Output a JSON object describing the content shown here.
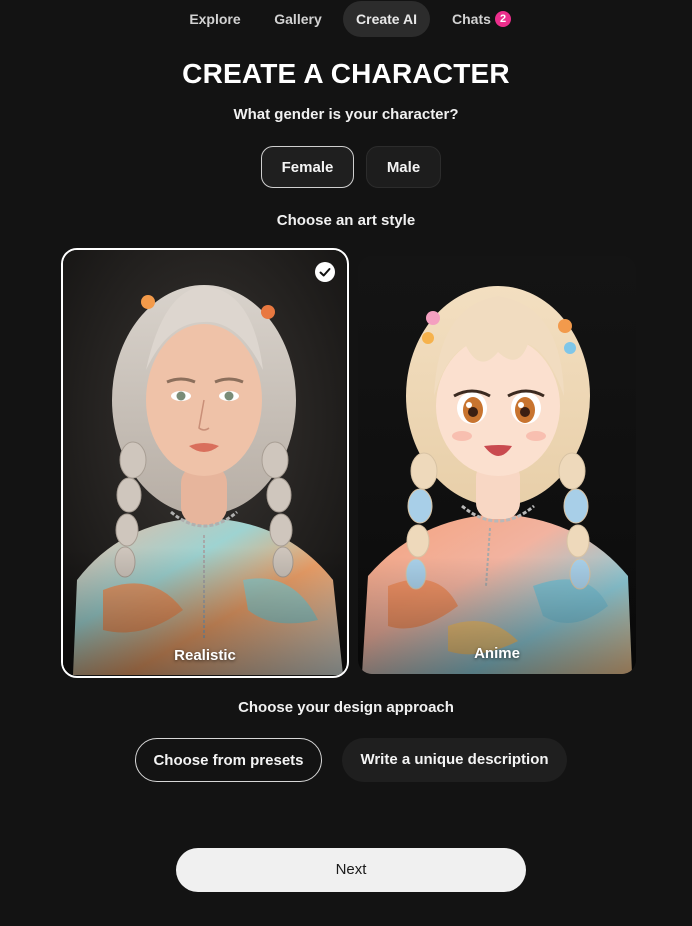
{
  "nav": {
    "items": [
      {
        "label": "Explore"
      },
      {
        "label": "Gallery"
      },
      {
        "label": "Create AI"
      },
      {
        "label": "Chats"
      }
    ],
    "chats_badge": "2",
    "active": "Create AI"
  },
  "header": {
    "title": "CREATE A CHARACTER"
  },
  "gender": {
    "question": "What gender is your character?",
    "options": [
      "Female",
      "Male"
    ],
    "selected": "Female"
  },
  "art_style": {
    "question": "Choose an art style",
    "options": [
      {
        "label": "Realistic"
      },
      {
        "label": "Anime"
      }
    ],
    "selected": "Realistic"
  },
  "design": {
    "question": "Choose your design approach",
    "options": [
      "Choose from presets",
      "Write a unique description"
    ],
    "selected": "Choose from presets"
  },
  "next_label": "Next",
  "colors": {
    "background": "#131313",
    "badge": "#ec2e8c",
    "next_button": "#f0f0f0"
  }
}
